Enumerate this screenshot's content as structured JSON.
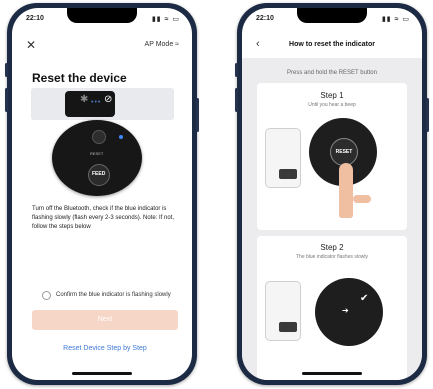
{
  "left_screen": {
    "status_time": "22:10",
    "status_icons": "▮▮ ≈ ▭",
    "close_icon": "✕",
    "ap_mode": "AP Mode ≈",
    "title": "Reset the device",
    "reset_label": "RESET",
    "feed_label": "FEED",
    "instructions": "Turn off the Bluetooth, check if the blue indicator is flashing slowly (flash every 2-3 seconds). Note: If not, follow the steps below",
    "confirm_text": "Confirm the blue indicator is flashing slowly",
    "next_label": "Next",
    "reset_link": "Reset Device Step by Step"
  },
  "right_screen": {
    "status_time": "22:10",
    "status_icons": "▮▮ ≈ ▭",
    "back_icon": "‹",
    "title": "How to reset the indicator",
    "subtitle": "Press and hold the RESET button",
    "step1": {
      "title": "Step 1",
      "desc": "Until you hear a beep",
      "button_label": "RESET"
    },
    "step2": {
      "title": "Step 2",
      "desc": "The blue indicator flashes slowly"
    }
  },
  "colors": {
    "phone_frame": "#1c2a44",
    "accent_blue": "#3f79d8",
    "next_button": "#f6d6c6",
    "finger": "#f0bfa2"
  },
  "icons": [
    "close-icon",
    "back-icon",
    "bluetooth-icon",
    "bluetooth-off-icon",
    "check-icon",
    "arrow-icon"
  ]
}
